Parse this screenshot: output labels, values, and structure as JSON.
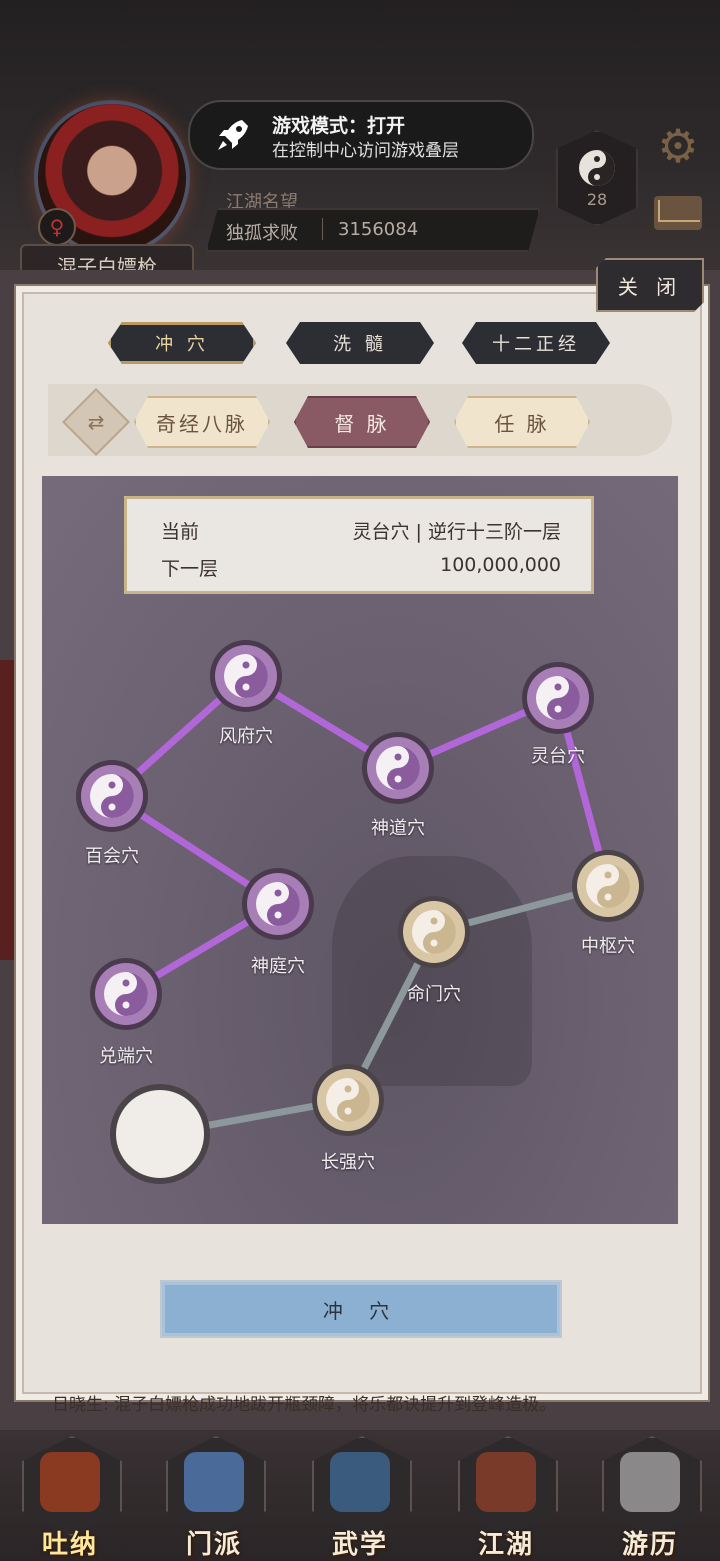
{
  "toast": {
    "title": "游戏模式：打开",
    "subtitle": "在控制中心访问游戏叠层"
  },
  "player": {
    "name": "混子白嫖枪",
    "fame_label": "江湖名望",
    "title": "独孤求败",
    "fame_value": "3156084",
    "badge_level": "28"
  },
  "panel": {
    "close_label": "关 闭",
    "tabs": [
      {
        "label": "冲 穴",
        "active": true
      },
      {
        "label": "洗 髓",
        "active": false
      },
      {
        "label": "十二正经",
        "active": false
      }
    ],
    "meridians": [
      {
        "label": "奇经八脉",
        "active": false
      },
      {
        "label": "督 脉",
        "active": true
      },
      {
        "label": "任 脉",
        "active": false
      }
    ],
    "info": {
      "current_label": "当前",
      "current_value": "灵台穴 | 逆行十三阶一层",
      "next_label": "下一层",
      "next_value": "100,000,000"
    },
    "nodes": [
      {
        "name": "风府穴",
        "state": "opened"
      },
      {
        "name": "神道穴",
        "state": "opened"
      },
      {
        "name": "灵台穴",
        "state": "opened"
      },
      {
        "name": "百会穴",
        "state": "opened"
      },
      {
        "name": "中枢穴",
        "state": "locked"
      },
      {
        "name": "神庭穴",
        "state": "opened"
      },
      {
        "name": "命门穴",
        "state": "locked"
      },
      {
        "name": "兑端穴",
        "state": "opened"
      },
      {
        "name": "长强穴",
        "state": "locked"
      }
    ],
    "action_button": "冲 穴"
  },
  "log_text": "日晓生: 混子白嫖枪成功地跋开瓶颈障，将乐都诀提升到登峰造极。",
  "nav": [
    {
      "label": "吐纳",
      "active": true
    },
    {
      "label": "门派",
      "active": false
    },
    {
      "label": "武学",
      "active": false
    },
    {
      "label": "江湖",
      "active": false
    },
    {
      "label": "游历",
      "active": false
    }
  ],
  "colors": {
    "opened": "#a77fb6",
    "locked": "#d8c6a4",
    "link_opened": "#b267d8",
    "link_locked": "#8c989c",
    "button": "#8cb0d2"
  }
}
